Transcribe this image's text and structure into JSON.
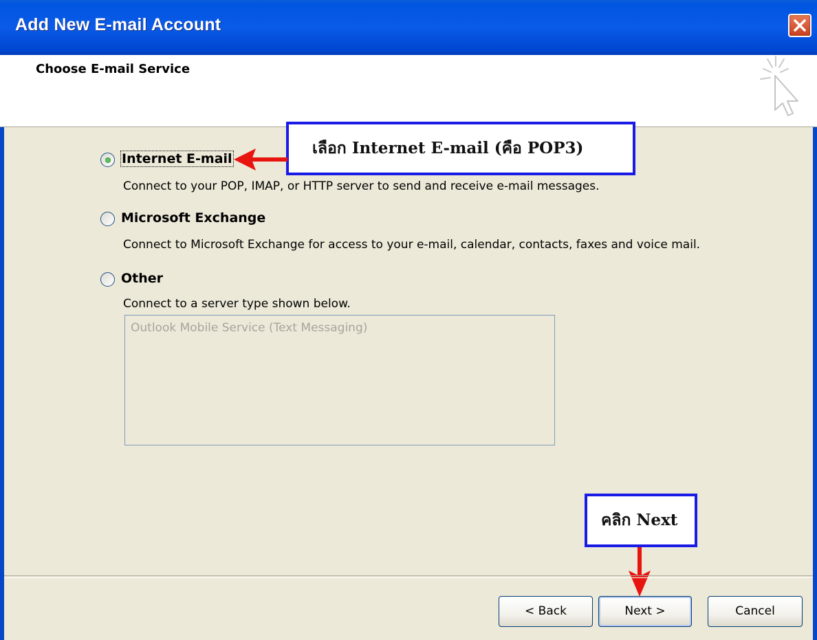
{
  "window": {
    "title": "Add New E-mail Account",
    "close_icon": "close-x-icon"
  },
  "header": {
    "title": "Choose E-mail Service",
    "icon": "wizard-cursor-icon"
  },
  "options": [
    {
      "label": "Internet E-mail",
      "description": "Connect to your POP, IMAP, or HTTP server to send and receive e-mail messages.",
      "selected": true
    },
    {
      "label": "Microsoft Exchange",
      "description": "Connect to Microsoft Exchange for access to your e-mail, calendar, contacts, faxes and voice mail.",
      "selected": false
    },
    {
      "label": "Other",
      "description": "Connect to a server type shown below.",
      "selected": false
    }
  ],
  "other_services": {
    "items": [
      "Outlook Mobile Service (Text Messaging)"
    ]
  },
  "annotations": {
    "callout_option": "เลือก Internet E-mail (คือ POP3)",
    "callout_next": "คลิก Next",
    "arrow_color": "#e8140f",
    "box_color": "#1a1ae6"
  },
  "buttons": {
    "back": "< Back",
    "next": "Next >",
    "cancel": "Cancel"
  },
  "colors": {
    "titlebar": "#0a5ae8",
    "dialog_bg": "#ece9d8",
    "close_button": "#d9532f"
  }
}
